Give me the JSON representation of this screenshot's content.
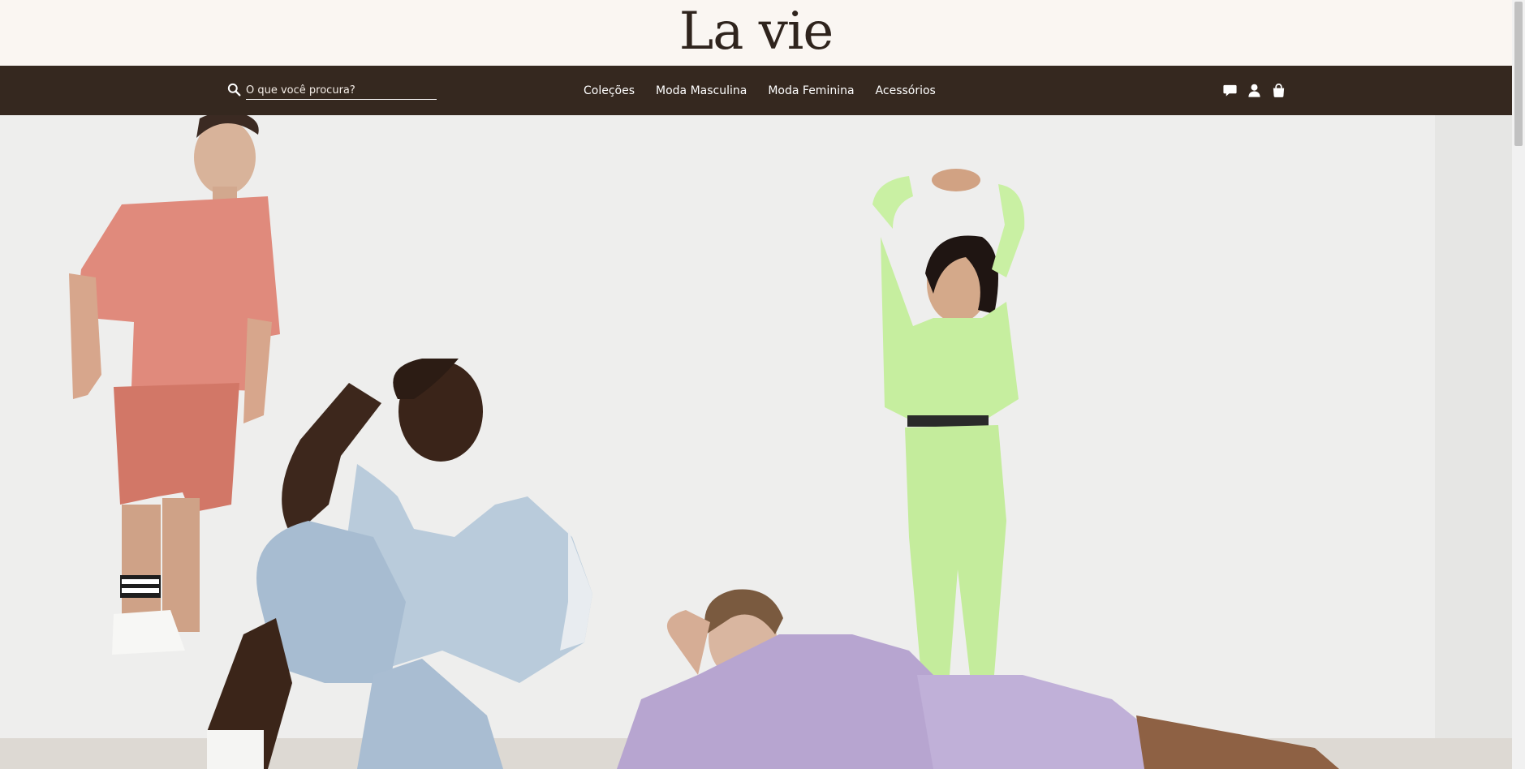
{
  "brand": {
    "logo_text": "La vie"
  },
  "search": {
    "placeholder": "O que você procura?",
    "value": "",
    "icon": "search-icon"
  },
  "nav": {
    "links": [
      {
        "label": "Coleções"
      },
      {
        "label": "Moda Masculina"
      },
      {
        "label": "Moda Feminina"
      },
      {
        "label": "Acessórios"
      }
    ],
    "icons": [
      "chat-icon",
      "user-icon",
      "shopping-bag-icon"
    ]
  },
  "hero": {
    "image_description": "Four models in pastel loungewear (coral, light blue, mint green, lilac) against a white wall"
  },
  "colors": {
    "topbar_bg": "#faf6f2",
    "navbar_bg": "#35281f",
    "logo": "#2f241d",
    "nav_text": "#ffffff"
  }
}
